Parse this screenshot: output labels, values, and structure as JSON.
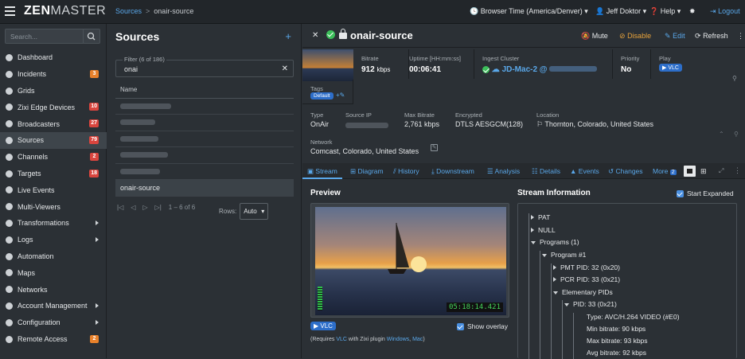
{
  "topbar": {
    "logo_a": "ZEN",
    "logo_b": "MASTER",
    "breadcrumb_root": "Sources",
    "breadcrumb_current": "onair-source",
    "browser_time": "Browser Time (America/Denver)",
    "user": "Jeff Doktor",
    "help": "Help",
    "logout": "Logout"
  },
  "sidebar": {
    "search_placeholder": "Search...",
    "items": [
      {
        "label": "Dashboard",
        "icon": "dashboard-icon"
      },
      {
        "label": "Incidents",
        "icon": "incidents-icon",
        "badge": "3",
        "badge_color": "#e8812b"
      },
      {
        "label": "Grids",
        "icon": "grid-icon"
      },
      {
        "label": "Zixi Edge Devices",
        "icon": "edge-icon",
        "badge": "10",
        "badge_color": "#d9453e"
      },
      {
        "label": "Broadcasters",
        "icon": "cloud-icon",
        "badge": "27",
        "badge_color": "#d9453e"
      },
      {
        "label": "Sources",
        "icon": "video-icon",
        "badge": "79",
        "badge_color": "#d9453e",
        "active": true
      },
      {
        "label": "Channels",
        "icon": "channels-icon",
        "badge": "2",
        "badge_color": "#d9453e"
      },
      {
        "label": "Targets",
        "icon": "share-icon",
        "badge": "18",
        "badge_color": "#d9453e"
      },
      {
        "label": "Live Events",
        "icon": "calendar-icon"
      },
      {
        "label": "Multi-Viewers",
        "icon": "multiviewer-icon"
      },
      {
        "label": "Transformations",
        "icon": "transform-icon",
        "submenu": true
      },
      {
        "label": "Logs",
        "icon": "warning-icon",
        "submenu": true
      },
      {
        "label": "Automation",
        "icon": "automation-icon"
      },
      {
        "label": "Maps",
        "icon": "map-icon"
      },
      {
        "label": "Networks",
        "icon": "network-icon"
      },
      {
        "label": "Account Management",
        "icon": "users-icon",
        "submenu": true
      },
      {
        "label": "Configuration",
        "icon": "gear-icon",
        "submenu": true
      },
      {
        "label": "Remote Access",
        "icon": "remote-icon",
        "badge": "2",
        "badge_color": "#e8812b"
      }
    ]
  },
  "sources_list": {
    "title": "Sources",
    "filter_label": "Filter (6 of 186)",
    "filter_value": "onai",
    "column_name": "Name",
    "selected_row": "onair-source",
    "pager_text": "1 – 6 of 6",
    "rows_label": "Rows:",
    "rows_value": "Auto"
  },
  "detail": {
    "title": "onair-source",
    "mute": "Mute",
    "disable": "Disable",
    "edit": "Edit",
    "refresh": "Refresh",
    "bitrate_label": "Bitrate",
    "bitrate_value": "912",
    "bitrate_unit": "kbps",
    "uptime_label": "Uptime [HH:mm:ss]",
    "uptime_value": "00:06:41",
    "ingest_label": "Ingest Cluster",
    "ingest_value": "JD-Mac-2 @",
    "priority_label": "Priority",
    "priority_value": "No",
    "play_label": "Play",
    "play_button": "VLC",
    "tags_label": "Tags",
    "tag_default": "Default",
    "type_label": "Type",
    "type_value": "OnAir",
    "sourceip_label": "Source IP",
    "maxbitrate_label": "Max Bitrate",
    "maxbitrate_value": "2,761 kbps",
    "encrypted_label": "Encrypted",
    "encrypted_value": "DTLS AESGCM(128)",
    "location_label": "Location",
    "location_value": "Thornton, Colorado, United States",
    "network_label": "Network",
    "network_value": "Comcast, Colorado, United States"
  },
  "tabs": [
    "Stream",
    "Diagram",
    "History",
    "Downstream",
    "Analysis",
    "Details",
    "Events",
    "Changes",
    "More"
  ],
  "tabs_more_count": "2",
  "preview": {
    "title": "Preview",
    "timestamp": "05:18:14.421",
    "vlc_button": "VLC",
    "show_overlay": "Show overlay",
    "note_prefix": "(Requires",
    "note_vlc": "VLC",
    "note_mid": "with Zixi plugin",
    "note_windows": "Windows",
    "note_comma": ",",
    "note_mac": "Mac",
    "note_suffix": ")"
  },
  "stream_info": {
    "title": "Stream Information",
    "start_expanded": "Start Expanded",
    "tree": [
      "PAT",
      "NULL",
      "Programs (1)",
      "Program #1",
      "PMT PID: 32 (0x20)",
      "PCR PID: 33 (0x21)",
      "Elementary PIDs",
      "PID: 33 (0x21)",
      "Type: AVC/H.264 VIDEO (#E0)",
      "Min bitrate: 90 kbps",
      "Max bitrate: 93 kbps",
      "Avg bitrate: 92 kbps"
    ]
  }
}
